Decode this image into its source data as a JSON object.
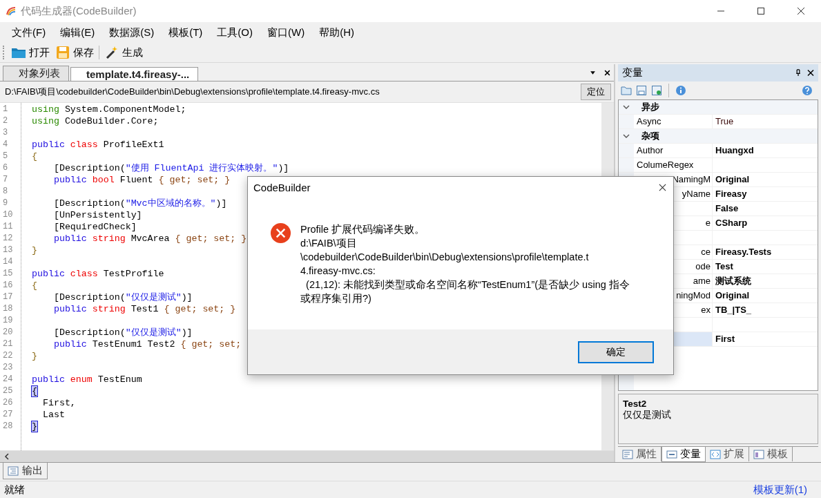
{
  "window": {
    "title": "代码生成器(CodeBuilder)"
  },
  "menu": [
    "文件(F)",
    "编辑(E)",
    "数据源(S)",
    "模板(T)",
    "工具(O)",
    "窗口(W)",
    "帮助(H)"
  ],
  "toolbar": [
    {
      "kind": "open",
      "label": "打开"
    },
    {
      "kind": "save",
      "label": "保存"
    },
    {
      "kind": "generate",
      "label": "生成"
    }
  ],
  "doc_tabs": [
    {
      "label": "对象列表",
      "selected": false
    },
    {
      "label": "template.t4.fireasy-...",
      "selected": true
    }
  ],
  "path_bar": {
    "path": "D:\\FAIB\\项目\\codebuilder\\CodeBuilder\\bin\\Debug\\extensions\\profile\\template.t4.fireasy-mvc.cs",
    "button": "定位"
  },
  "code_lines": [
    {
      "number": "1",
      "tokens": [
        {
          "text": "using",
          "kind": "directive"
        },
        {
          "text": " System.ComponentModel;",
          "kind": "plain"
        }
      ]
    },
    {
      "number": "2",
      "tokens": [
        {
          "text": "using",
          "kind": "directive"
        },
        {
          "text": " CodeBuilder.Core;",
          "kind": "plain"
        }
      ]
    },
    {
      "number": "3"
    },
    {
      "number": "4",
      "tokens": [
        {
          "text": "public",
          "kind": "keyword"
        },
        {
          "text": " class",
          "kind": "type"
        },
        {
          "text": " ProfileExt1",
          "kind": "plain"
        }
      ]
    },
    {
      "number": "5",
      "tokens": [
        {
          "text": "{",
          "kind": "brace"
        }
      ]
    },
    {
      "number": "6",
      "tokens": [
        {
          "text": "    [Description(",
          "kind": "plain"
        },
        {
          "text": "\"使用 FluentApi 进行实体映射。\"",
          "kind": "string"
        },
        {
          "text": ")]",
          "kind": "plain"
        }
      ]
    },
    {
      "number": "7",
      "tokens": [
        {
          "text": "    public",
          "kind": "keyword"
        },
        {
          "text": " bool",
          "kind": "type"
        },
        {
          "text": " Fluent",
          "kind": "plain"
        },
        {
          "text": " { get; set; }",
          "kind": "accessor"
        }
      ]
    },
    {
      "number": "8"
    },
    {
      "number": "9",
      "tokens": [
        {
          "text": "    [Description(",
          "kind": "plain"
        },
        {
          "text": "\"Mvc中区域的名称。\"",
          "kind": "string"
        },
        {
          "text": ")]",
          "kind": "plain"
        }
      ]
    },
    {
      "number": "10",
      "tokens": [
        {
          "text": "    [UnPersistently]",
          "kind": "plain"
        }
      ]
    },
    {
      "number": "11",
      "tokens": [
        {
          "text": "    [RequiredCheck]",
          "kind": "plain"
        }
      ]
    },
    {
      "number": "12",
      "tokens": [
        {
          "text": "    public",
          "kind": "keyword"
        },
        {
          "text": " string",
          "kind": "type"
        },
        {
          "text": " MvcArea",
          "kind": "plain"
        },
        {
          "text": " { get; set; }",
          "kind": "accessor"
        }
      ]
    },
    {
      "number": "13",
      "tokens": [
        {
          "text": "}",
          "kind": "brace"
        }
      ]
    },
    {
      "number": "14"
    },
    {
      "number": "15",
      "tokens": [
        {
          "text": "public",
          "kind": "keyword"
        },
        {
          "text": " class",
          "kind": "type"
        },
        {
          "text": " TestProfile",
          "kind": "plain"
        }
      ]
    },
    {
      "number": "16",
      "tokens": [
        {
          "text": "{",
          "kind": "brace"
        }
      ]
    },
    {
      "number": "17",
      "tokens": [
        {
          "text": "    [Description(",
          "kind": "plain"
        },
        {
          "text": "\"仅仅是测试\"",
          "kind": "string"
        },
        {
          "text": ")]",
          "kind": "plain"
        }
      ]
    },
    {
      "number": "18",
      "tokens": [
        {
          "text": "    public",
          "kind": "keyword"
        },
        {
          "text": " string",
          "kind": "type"
        },
        {
          "text": " Test1",
          "kind": "plain"
        },
        {
          "text": " { get; set; }",
          "kind": "accessor"
        }
      ]
    },
    {
      "number": "19"
    },
    {
      "number": "20",
      "tokens": [
        {
          "text": "    [Description(",
          "kind": "plain"
        },
        {
          "text": "\"仅仅是测试\"",
          "kind": "string"
        },
        {
          "text": ")]",
          "kind": "plain"
        }
      ]
    },
    {
      "number": "21",
      "tokens": [
        {
          "text": "    public",
          "kind": "keyword"
        },
        {
          "text": " TestEnum1 Test2",
          "kind": "plain"
        },
        {
          "text": " { get; set;",
          "kind": "accessor"
        }
      ]
    },
    {
      "number": "22",
      "tokens": [
        {
          "text": "}",
          "kind": "brace"
        }
      ]
    },
    {
      "number": "23"
    },
    {
      "number": "24",
      "tokens": [
        {
          "text": "public",
          "kind": "keyword"
        },
        {
          "text": " enum",
          "kind": "type"
        },
        {
          "text": " TestEnum",
          "kind": "plain"
        }
      ]
    },
    {
      "number": "25",
      "tokens": [
        {
          "text": "{",
          "kind": "matched_brace"
        }
      ]
    },
    {
      "number": "26",
      "tokens": [
        {
          "text": "  First,",
          "kind": "plain"
        }
      ]
    },
    {
      "number": "27",
      "tokens": [
        {
          "text": "  Last",
          "kind": "plain"
        }
      ]
    },
    {
      "number": "28",
      "tokens": [
        {
          "text": "}",
          "kind": "matched_brace"
        }
      ]
    }
  ],
  "output_tab": {
    "label": "输出"
  },
  "variables_panel": {
    "title": "变量",
    "grid_rows": [
      {
        "kind": "category",
        "name": "异步"
      },
      {
        "kind": "property",
        "name": "Async",
        "value": "True",
        "modified": false,
        "selected": false
      },
      {
        "kind": "category",
        "name": "杂项"
      },
      {
        "kind": "property",
        "name": "Author",
        "value": "Huangxd",
        "modified": true,
        "selected": false
      },
      {
        "kind": "property",
        "name": "ColumeRegex",
        "selected": false
      },
      {
        "kind": "partial",
        "name": "NamingM",
        "value": "Original",
        "modified": true,
        "selected": false
      },
      {
        "kind": "partial",
        "name": "yName",
        "value": "Fireasy",
        "modified": true,
        "selected": false
      },
      {
        "kind": "partial",
        "value": "False",
        "modified": true,
        "selected": false
      },
      {
        "kind": "partial",
        "name": "e",
        "value": "CSharp",
        "modified": true,
        "selected": false
      },
      {
        "kind": "partial",
        "selected": false
      },
      {
        "kind": "partial",
        "name": "ce",
        "value": "Fireasy.Tests",
        "modified": true,
        "selected": false
      },
      {
        "kind": "partial",
        "name": "ode",
        "value": "Test",
        "modified": true,
        "selected": false
      },
      {
        "kind": "partial",
        "name": "ame",
        "value": "测试系统",
        "modified": true,
        "selected": false
      },
      {
        "kind": "partial",
        "name": "ningMod",
        "value": "Original",
        "modified": true,
        "selected": false
      },
      {
        "kind": "partial",
        "name": "ex",
        "value": "TB_|TS_",
        "modified": true,
        "selected": false
      },
      {
        "kind": "partial",
        "selected": false
      },
      {
        "kind": "partial",
        "value": "First",
        "modified": true,
        "selected": true
      }
    ],
    "description": {
      "title": "Test2",
      "text": "仅仅是测试"
    },
    "tabs": [
      {
        "kind": "properties",
        "label": "属性",
        "selected": false
      },
      {
        "kind": "variables",
        "label": "变量",
        "selected": true
      },
      {
        "kind": "extensions",
        "label": "扩展",
        "selected": false
      },
      {
        "kind": "templates",
        "label": "模板",
        "selected": false
      }
    ]
  },
  "status_bar": {
    "text": "就绪",
    "link": "模板更新(1)"
  },
  "dialog": {
    "title": "CodeBuilder",
    "message_lines": [
      "Profile 扩展代码编译失败。",
      "d:\\FAIB\\项目",
      "\\codebuilder\\CodeBuilder\\bin\\Debug\\extensions\\profile\\template.t",
      "4.fireasy-mvc.cs:",
      "  (21,12): 未能找到类型或命名空间名称“TestEnum1”(是否缺少 using 指令",
      "或程序集引用?)"
    ],
    "button": "确定"
  }
}
